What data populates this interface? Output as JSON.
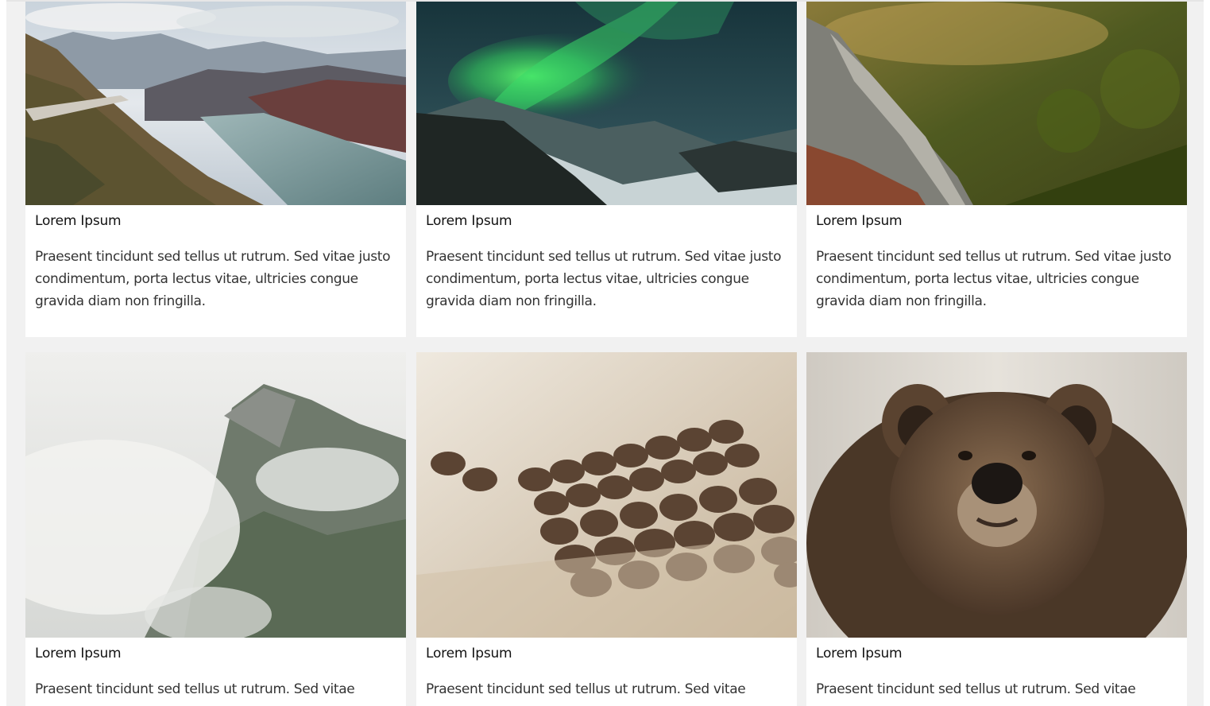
{
  "cards": [
    {
      "title": "Lorem Ipsum",
      "text": "Praesent tincidunt sed tellus ut rutrum. Sed vitae justo condimentum, porta lectus vitae, ultricies congue gravida diam non fringilla.",
      "image": "mountain-lake-road"
    },
    {
      "title": "Lorem Ipsum",
      "text": "Praesent tincidunt sed tellus ut rutrum. Sed vitae justo condimentum, porta lectus vitae, ultricies congue gravida diam non fringilla.",
      "image": "northern-lights"
    },
    {
      "title": "Lorem Ipsum",
      "text": "Praesent tincidunt sed tellus ut rutrum. Sed vitae justo condimentum, porta lectus vitae, ultricies congue gravida diam non fringilla.",
      "image": "forest-waterfall"
    },
    {
      "title": "Lorem Ipsum",
      "text": "Praesent tincidunt sed tellus ut rutrum. Sed vitae",
      "image": "misty-mountain"
    },
    {
      "title": "Lorem Ipsum",
      "text": "Praesent tincidunt sed tellus ut rutrum. Sed vitae",
      "image": "coffee-beans"
    },
    {
      "title": "Lorem Ipsum",
      "text": "Praesent tincidunt sed tellus ut rutrum. Sed vitae",
      "image": "brown-bear"
    }
  ],
  "colors": {
    "background": "#f1f1f1",
    "card": "#ffffff",
    "title": "#111111",
    "text": "#333333"
  }
}
